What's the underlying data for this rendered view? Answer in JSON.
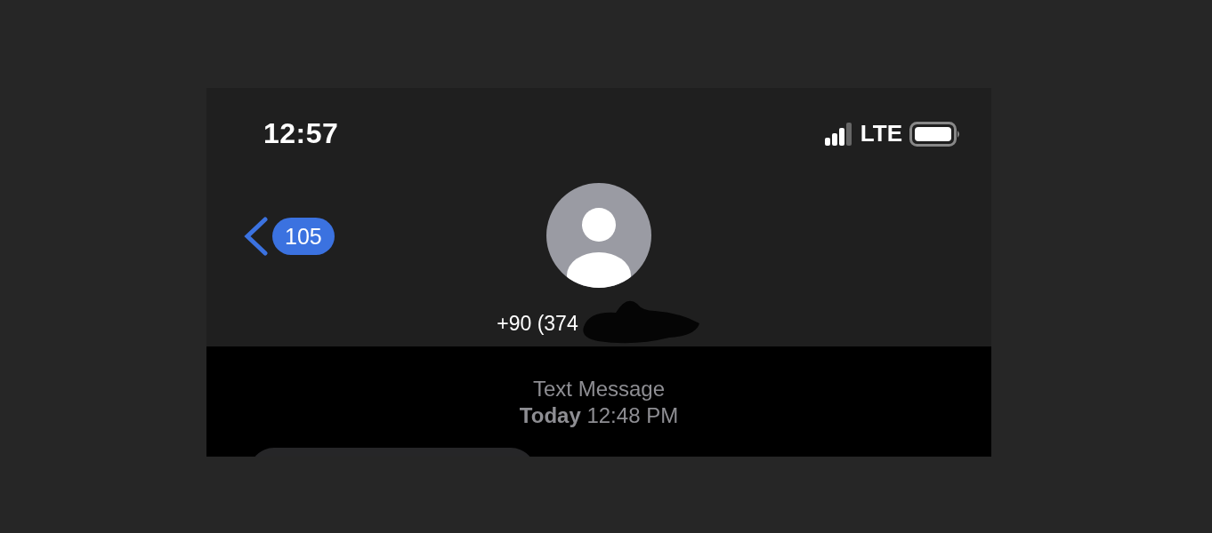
{
  "status_bar": {
    "time": "12:57",
    "network": "LTE"
  },
  "header": {
    "back_count": "105",
    "contact": "+90 (374",
    "contact_redacted": true
  },
  "thread": {
    "service": "Text Message",
    "timestamp": "**Today** 12:48 PM"
  }
}
